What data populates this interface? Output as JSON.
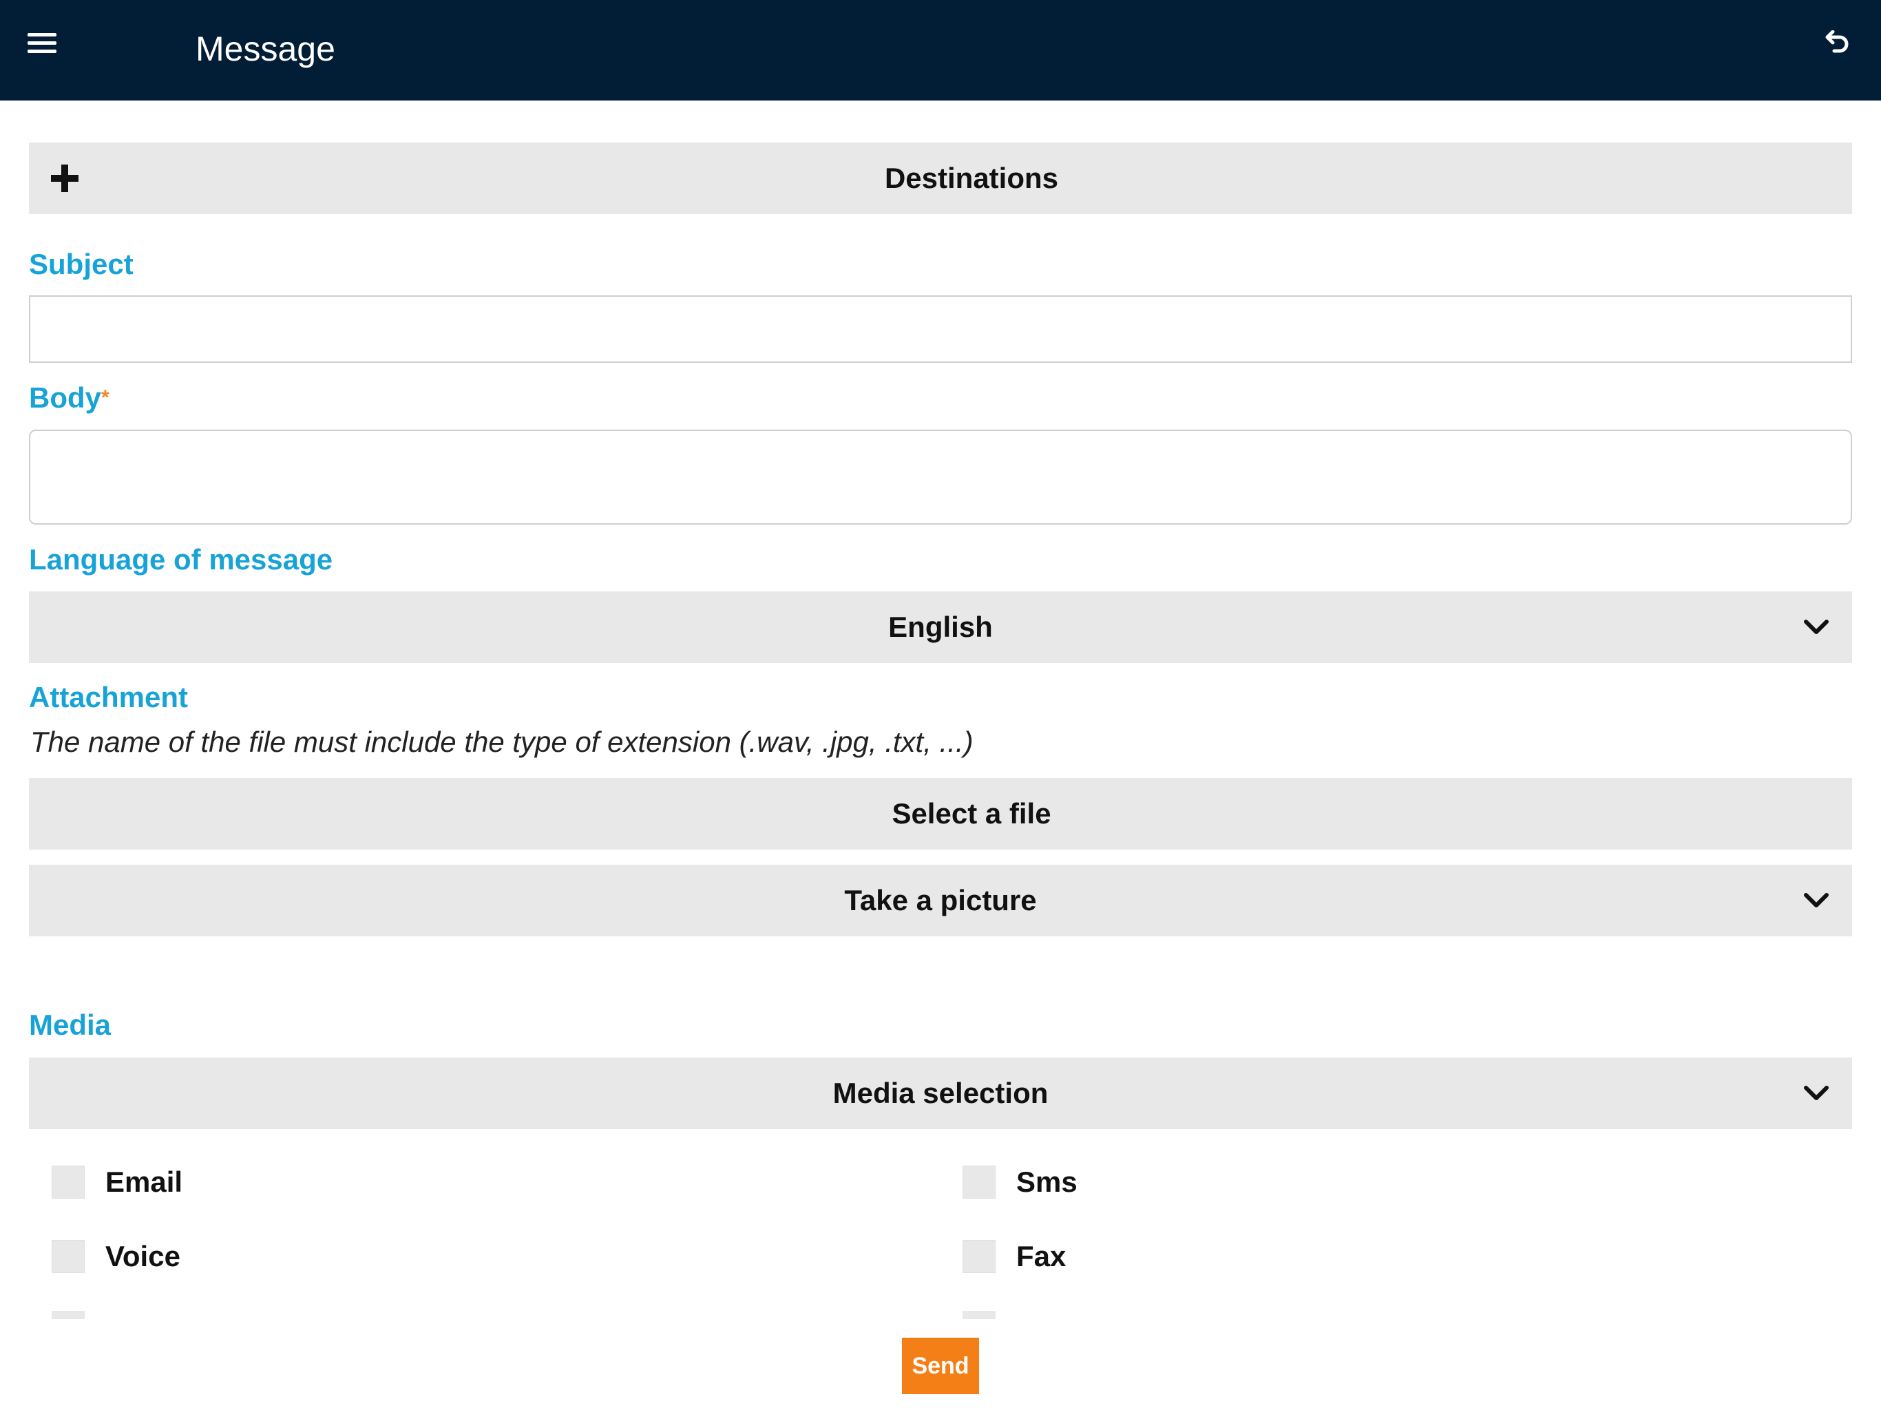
{
  "header": {
    "title": "Message",
    "menu_icon": "hamburger-menu-icon",
    "back_icon": "undo-arrow-icon",
    "background": "#021d36"
  },
  "destinations": {
    "label": "Destinations",
    "icon": "plus-icon"
  },
  "subject": {
    "label": "Subject",
    "value": "",
    "placeholder": ""
  },
  "body": {
    "label": "Body",
    "required_mark": "*",
    "value": "",
    "placeholder": ""
  },
  "language": {
    "label": "Language of message",
    "selected": "English",
    "icon": "chevron-down-icon"
  },
  "attachment": {
    "label": "Attachment",
    "hint": "The name of the file must include the type of extension (.wav, .jpg, .txt, ...)",
    "select_file_label": "Select a file",
    "take_picture_label": "Take a picture"
  },
  "media": {
    "label": "Media",
    "selection_label": "Media selection",
    "options": [
      {
        "label": "Email",
        "checked": false
      },
      {
        "label": "Sms",
        "checked": false
      },
      {
        "label": "Voice",
        "checked": false
      },
      {
        "label": "Fax",
        "checked": false
      }
    ]
  },
  "actions": {
    "send_label": "Send"
  },
  "colors": {
    "accent_label": "#18a3d8",
    "send_button": "#f57f17",
    "bar_background": "#e8e8e8"
  }
}
